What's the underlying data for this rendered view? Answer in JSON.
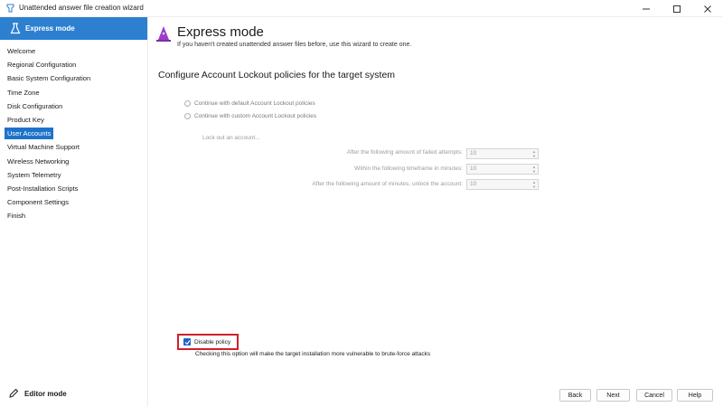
{
  "window": {
    "title": "Unattended answer file creation wizard"
  },
  "sidebar": {
    "header_label": "Express mode",
    "items": [
      {
        "label": "Welcome",
        "active": false
      },
      {
        "label": "Regional Configuration",
        "active": false
      },
      {
        "label": "Basic System Configuration",
        "active": false
      },
      {
        "label": "Time Zone",
        "active": false
      },
      {
        "label": "Disk Configuration",
        "active": false
      },
      {
        "label": "Product Key",
        "active": false
      },
      {
        "label": "User Accounts",
        "active": true
      },
      {
        "label": "Virtual Machine Support",
        "active": false
      },
      {
        "label": "Wireless Networking",
        "active": false
      },
      {
        "label": "System Telemetry",
        "active": false
      },
      {
        "label": "Post-Installation Scripts",
        "active": false
      },
      {
        "label": "Component Settings",
        "active": false
      },
      {
        "label": "Finish",
        "active": false
      }
    ],
    "editor_mode_label": "Editor mode"
  },
  "main": {
    "title": "Express mode",
    "subtitle": "If you haven't created unattended answer files before, use this wizard to create one.",
    "section_heading": "Configure Account Lockout policies for the target system",
    "radio_default": "Continue with default Account Lockout policies",
    "radio_custom": "Continue with custom Account Lockout policies",
    "lockout_link": "Lock out an account...",
    "fields": [
      {
        "label": "After the following amount of failed attempts:",
        "value": "10"
      },
      {
        "label": "Within the following timeframe in minutes:",
        "value": "10"
      },
      {
        "label": "After the following amount of minutes, unlock the account:",
        "value": "10"
      }
    ],
    "disable_policy_label": "Disable policy",
    "disable_policy_checked": true,
    "warning_text": "Checking this option will make the target installation more vulnerable to brute-force attacks"
  },
  "footer": {
    "back_label": "Back",
    "next_label": "Next",
    "cancel_label": "Cancel",
    "help_label": "Help"
  },
  "colors": {
    "accent": "#2d7fd0",
    "active_item": "#1e73c8",
    "highlight_border": "#d0202a",
    "wizard_icon": "#9b3fc7"
  }
}
